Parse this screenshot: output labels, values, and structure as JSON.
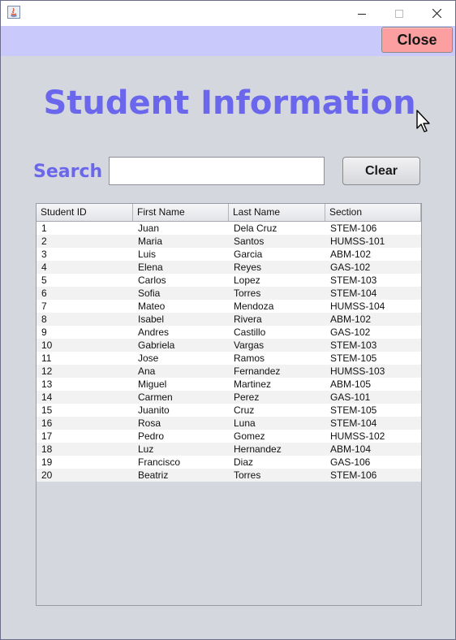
{
  "window": {
    "icons": {
      "app": "java-icon",
      "minimize": "minimize-icon",
      "maximize": "maximize-icon",
      "close": "close-icon"
    }
  },
  "header": {
    "close_label": "Close"
  },
  "title": "Student Information",
  "search": {
    "label": "Search",
    "value": "",
    "placeholder": "",
    "clear_label": "Clear"
  },
  "table": {
    "columns": [
      "Student ID",
      "First Name",
      "Last Name",
      "Section"
    ],
    "rows": [
      [
        "1",
        "Juan",
        "Dela Cruz",
        "STEM-106"
      ],
      [
        "2",
        "Maria",
        "Santos",
        "HUMSS-101"
      ],
      [
        "3",
        "Luis",
        "Garcia",
        "ABM-102"
      ],
      [
        "4",
        "Elena",
        "Reyes",
        "GAS-102"
      ],
      [
        "5",
        "Carlos",
        "Lopez",
        "STEM-103"
      ],
      [
        "6",
        "Sofia",
        "Torres",
        "STEM-104"
      ],
      [
        "7",
        "Mateo",
        "Mendoza",
        "HUMSS-104"
      ],
      [
        "8",
        "Isabel",
        "Rivera",
        "ABM-102"
      ],
      [
        "9",
        "Andres",
        "Castillo",
        "GAS-102"
      ],
      [
        "10",
        "Gabriela",
        "Vargas",
        "STEM-103"
      ],
      [
        "11",
        "Jose",
        "Ramos",
        "STEM-105"
      ],
      [
        "12",
        "Ana",
        "Fernandez",
        "HUMSS-103"
      ],
      [
        "13",
        "Miguel",
        "Martinez",
        "ABM-105"
      ],
      [
        "14",
        "Carmen",
        "Perez",
        "GAS-101"
      ],
      [
        "15",
        "Juanito",
        "Cruz",
        "STEM-105"
      ],
      [
        "16",
        "Rosa",
        "Luna",
        "STEM-104"
      ],
      [
        "17",
        "Pedro",
        "Gomez",
        "HUMSS-102"
      ],
      [
        "18",
        "Luz",
        "Hernandez",
        "ABM-104"
      ],
      [
        "19",
        "Francisco",
        "Diaz",
        "GAS-106"
      ],
      [
        "20",
        "Beatriz",
        "Torres",
        "STEM-106"
      ]
    ]
  },
  "colors": {
    "accent": "#6a67ec",
    "header_bar": "#cac9fb",
    "close_button": "#fb9fa0",
    "background": "#d5d7de"
  }
}
